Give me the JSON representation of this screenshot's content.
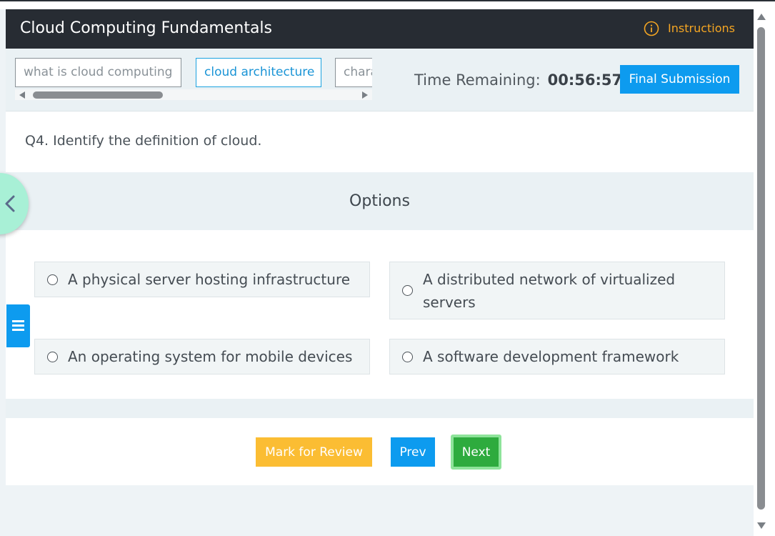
{
  "header": {
    "title": "Cloud Computing Fundamentals",
    "instructions_label": "Instructions",
    "instructions_icon": "info-circle-icon",
    "accent_color": "#f5a623"
  },
  "topics": [
    {
      "label": "what is cloud computing",
      "active": false
    },
    {
      "label": "cloud architecture",
      "active": true
    },
    {
      "label": "characteristics",
      "active": false
    }
  ],
  "timer": {
    "label": "Time Remaining:",
    "value": "00:56:57"
  },
  "final_submission_label": "Final Submission",
  "question": {
    "text": "Q4. Identify the definition of cloud."
  },
  "options_heading": "Options",
  "options": [
    {
      "label": "A physical server hosting infrastructure",
      "selected": false
    },
    {
      "label": "A distributed network of virtualized servers",
      "selected": false
    },
    {
      "label": "An operating system for mobile devices",
      "selected": false
    },
    {
      "label": "A software development framework",
      "selected": false
    }
  ],
  "actions": {
    "review_label": "Mark for Review",
    "prev_label": "Prev",
    "next_label": "Next"
  },
  "colors": {
    "header_bg": "#272c33",
    "primary": "#0d9bef",
    "review": "#fbbd33",
    "next": "#2eab3e",
    "back_circle": "#a8f0d6"
  }
}
